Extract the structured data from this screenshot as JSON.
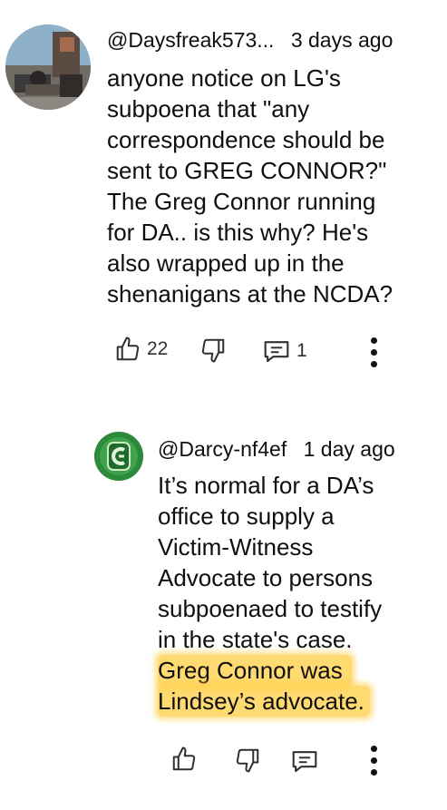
{
  "comments": [
    {
      "handle": "@Daysfreak573...",
      "time": "3 days ago",
      "lines": [
        "anyone notice on LG's",
        "subpoena that \"any",
        "correspondence should be",
        "sent to GREG CONNOR?\"",
        "The Greg Connor running",
        "for DA.. is this why? He's",
        "also wrapped up in the",
        "shenanigans at the NCDA?"
      ],
      "like_count": "22",
      "reply_count": "1",
      "avatar_icon": "profile-photo"
    },
    {
      "handle": "@Darcy-nf4ef",
      "time": "1 day ago",
      "lines": [
        "It’s normal for a DA’s",
        "office to supply a",
        "Victim-Witness",
        "Advocate to persons",
        "subpoenaed to testify",
        "in the state's case.",
        "Greg Connor was",
        "Lindsey’s advocate."
      ],
      "avatar_icon": "green-logo-avatar"
    }
  ],
  "colors": {
    "highlight": "#FFCE40",
    "text": "#0F0F0F",
    "icon": "#303030"
  }
}
